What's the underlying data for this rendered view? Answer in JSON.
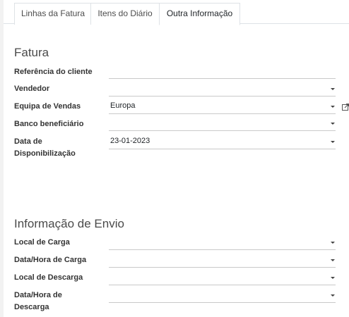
{
  "tabs": [
    {
      "label": "Linhas da Fatura"
    },
    {
      "label": "Itens do Diário"
    },
    {
      "label": "Outra Informação"
    }
  ],
  "fatura": {
    "title": "Fatura",
    "fields": [
      {
        "label": "Referência do cliente",
        "value": ""
      },
      {
        "label": "Vendedor",
        "value": ""
      },
      {
        "label": "Equipa de Vendas",
        "value": "Europa"
      },
      {
        "label": "Banco beneficiário",
        "value": ""
      },
      {
        "label_line1": "Data de",
        "label_line2": "Disponibilização",
        "value": "23-01-2023"
      }
    ]
  },
  "envio": {
    "title": "Informação de Envio",
    "fields": [
      {
        "label": "Local de Carga",
        "value": ""
      },
      {
        "label": "Data/Hora de Carga",
        "value": ""
      },
      {
        "label": "Local de Descarga",
        "value": ""
      },
      {
        "label_line1": "Data/Hora de",
        "label_line2": "Descarga",
        "value": ""
      }
    ]
  },
  "colors": {
    "accent": "#714B67",
    "border": "#dee2e6",
    "field_line": "#c9c9c9"
  },
  "icons": {
    "dropdown": "caret-down-icon",
    "external": "external-link-icon"
  }
}
